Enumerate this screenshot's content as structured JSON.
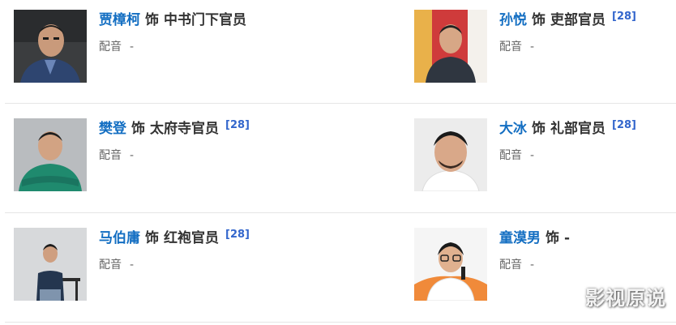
{
  "cast": [
    {
      "actor": "贾樟柯",
      "as": "饰",
      "role": "中书门下官员",
      "ref": "",
      "dub_label": "配音",
      "dub_value": "-",
      "photo": {
        "bg": "#3b3d3f",
        "skin": "#c99a7b",
        "hair": "#1c1c1c",
        "cloth": "#2e4570"
      }
    },
    {
      "actor": "孙悦",
      "as": "饰",
      "role": "吏部官员",
      "ref": "[28]",
      "dub_label": "配音",
      "dub_value": "-",
      "photo": {
        "bg": "#cf3b3b",
        "skin": "#d7a786",
        "hair": "#222222",
        "cloth": "#2f3640"
      }
    },
    {
      "actor": "樊登",
      "as": "饰",
      "role": "太府寺官员",
      "ref": "[28]",
      "dub_label": "配音",
      "dub_value": "-",
      "photo": {
        "bg": "#b9bcbf",
        "skin": "#d2a383",
        "hair": "#1f1f1f",
        "cloth": "#1f8a6e"
      }
    },
    {
      "actor": "大冰",
      "as": "饰",
      "role": "礼部官员",
      "ref": "[28]",
      "dub_label": "配音",
      "dub_value": "-",
      "photo": {
        "bg": "#ececec",
        "skin": "#d9a889",
        "hair": "#1a1a1a",
        "cloth": "#ffffff"
      }
    },
    {
      "actor": "马伯庸",
      "as": "饰",
      "role": "红袍官员",
      "ref": "[28]",
      "dub_label": "配音",
      "dub_value": "-",
      "photo": {
        "bg": "#d7d9db",
        "skin": "#cf9f80",
        "hair": "#1c1c1c",
        "cloth": "#24364f"
      }
    },
    {
      "actor": "童漠男",
      "as": "饰",
      "role": "-",
      "ref": "",
      "dub_label": "配音",
      "dub_value": "-",
      "photo": {
        "bg": "#f5f5f5",
        "skin": "#e0b18f",
        "hair": "#1a1a1a",
        "cloth": "#ffffff",
        "accent": "#f08a3a"
      }
    }
  ],
  "watermark": "影视原说"
}
